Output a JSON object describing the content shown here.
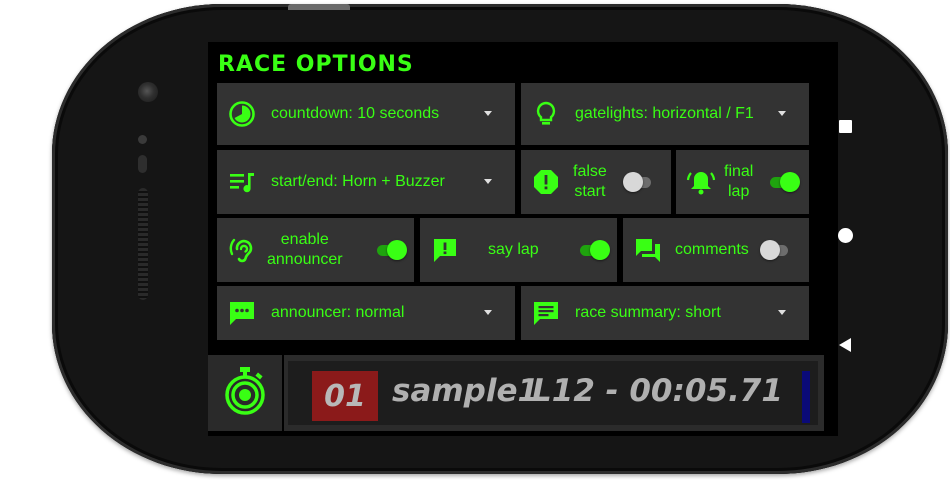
{
  "title": "RACE OPTIONS",
  "colors": {
    "accent": "#39ff14",
    "tile": "#333333",
    "race_number_bg": "#8b1a1a"
  },
  "options": {
    "countdown": {
      "icon": "timer-icon",
      "label": "countdown: 10 seconds"
    },
    "gatelights": {
      "icon": "lightbulb-icon",
      "label": "gatelights: horizontal / F1"
    },
    "start_end": {
      "icon": "music-list-icon",
      "label": "start/end: Horn + Buzzer"
    },
    "false_start": {
      "icon": "warning-octagon-icon",
      "label_line1": "false",
      "label_line2": "start",
      "enabled": false
    },
    "final_lap": {
      "icon": "bell-ring-icon",
      "label_line1": "final",
      "label_line2": "lap",
      "enabled": true
    },
    "announcer_enable": {
      "icon": "hearing-icon",
      "label_line1": "enable",
      "label_line2": "announcer",
      "enabled": true
    },
    "say_lap": {
      "icon": "speech-alert-icon",
      "label": "say lap",
      "enabled": true
    },
    "comments": {
      "icon": "forum-icon",
      "label": "comments",
      "enabled": false
    },
    "announcer": {
      "icon": "message-dots-icon",
      "label": "announcer: normal"
    },
    "race_summary": {
      "icon": "message-text-icon",
      "label": "race summary: short"
    }
  },
  "status_bar": {
    "race_number": "01",
    "racer": "sample1",
    "lap_time": "L12 - 00:05.71"
  },
  "nav": [
    "recents-button",
    "home-button",
    "back-button"
  ]
}
